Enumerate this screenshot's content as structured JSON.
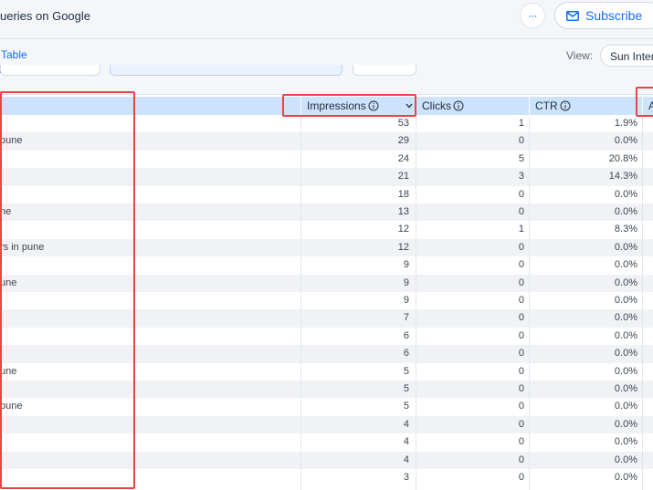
{
  "header": {
    "title": "ueries on Google",
    "more_label": "···",
    "subscribe_label": "Subscribe"
  },
  "toolbar": {
    "tab_table_label": "Table",
    "view_label": "View:",
    "view_value": "Sun Inter"
  },
  "table": {
    "columns": [
      {
        "label": "Impressions",
        "has_info": true,
        "sorted": "desc"
      },
      {
        "label": "Clicks",
        "has_info": true
      },
      {
        "label": "CTR",
        "has_info": true
      },
      {
        "label": "A",
        "has_info": false
      }
    ],
    "rows": [
      {
        "query": "",
        "impressions": "53",
        "clicks": "1",
        "ctr": "1.9%"
      },
      {
        "query": "pune",
        "impressions": "29",
        "clicks": "0",
        "ctr": "0.0%"
      },
      {
        "query": "",
        "impressions": "24",
        "clicks": "5",
        "ctr": "20.8%"
      },
      {
        "query": "",
        "impressions": "21",
        "clicks": "3",
        "ctr": "14.3%"
      },
      {
        "query": "",
        "impressions": "18",
        "clicks": "0",
        "ctr": "0.0%"
      },
      {
        "query": "ne",
        "impressions": "13",
        "clicks": "0",
        "ctr": "0.0%"
      },
      {
        "query": "",
        "impressions": "12",
        "clicks": "1",
        "ctr": "8.3%"
      },
      {
        "query": "rs in pune",
        "impressions": "12",
        "clicks": "0",
        "ctr": "0.0%"
      },
      {
        "query": "",
        "impressions": "9",
        "clicks": "0",
        "ctr": "0.0%"
      },
      {
        "query": "une",
        "impressions": "9",
        "clicks": "0",
        "ctr": "0.0%"
      },
      {
        "query": "",
        "impressions": "9",
        "clicks": "0",
        "ctr": "0.0%"
      },
      {
        "query": "",
        "impressions": "7",
        "clicks": "0",
        "ctr": "0.0%"
      },
      {
        "query": "",
        "impressions": "6",
        "clicks": "0",
        "ctr": "0.0%"
      },
      {
        "query": "",
        "impressions": "6",
        "clicks": "0",
        "ctr": "0.0%"
      },
      {
        "query": "une",
        "impressions": "5",
        "clicks": "0",
        "ctr": "0.0%"
      },
      {
        "query": "",
        "impressions": "5",
        "clicks": "0",
        "ctr": "0.0%"
      },
      {
        "query": "pune",
        "impressions": "5",
        "clicks": "0",
        "ctr": "0.0%"
      },
      {
        "query": "",
        "impressions": "4",
        "clicks": "0",
        "ctr": "0.0%"
      },
      {
        "query": "",
        "impressions": "4",
        "clicks": "0",
        "ctr": "0.0%"
      },
      {
        "query": "",
        "impressions": "4",
        "clicks": "0",
        "ctr": "0.0%"
      },
      {
        "query": "",
        "impressions": "3",
        "clicks": "0",
        "ctr": "0.0%"
      }
    ]
  },
  "colors": {
    "accent": "#116dff",
    "header_row": "#cde2fb",
    "highlight": "#e84646"
  }
}
